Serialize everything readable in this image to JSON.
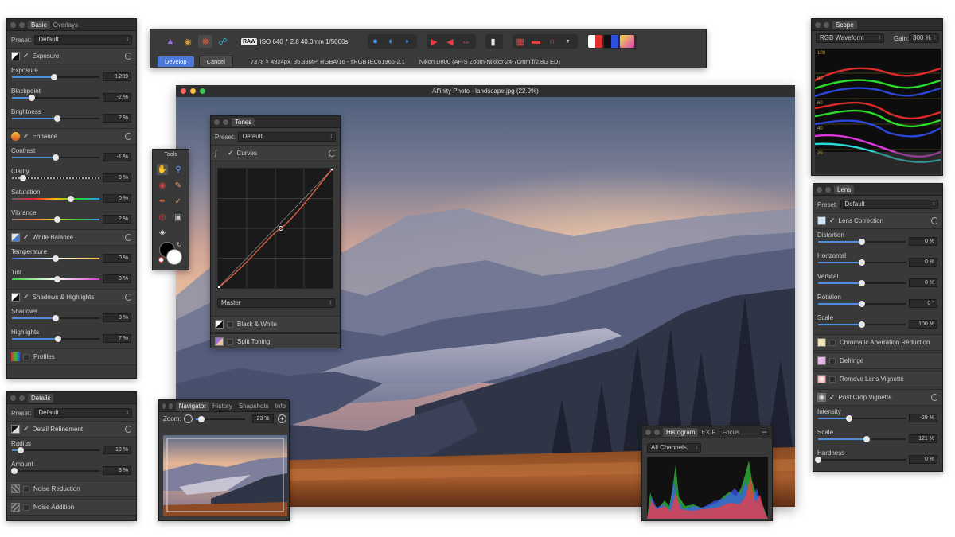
{
  "toolbar": {
    "raw_badge": "RAW",
    "exif_summary": "ISO 640 ƒ 2.8 40.0mm 1/5000s",
    "develop_label": "Develop",
    "cancel_label": "Cancel",
    "image_info": "7378 × 4924px, 36.33MP, RGBA/16 - sRGB IEC61966-2.1",
    "camera_info": "Nikon D800 (AF-S Zoom-Nikkor 24-70mm f/2.8G ED)"
  },
  "main_window": {
    "title": "Affinity Photo - landscape.jpg (22.9%)"
  },
  "basic_panel": {
    "tabs": [
      "Basic",
      "Overlays"
    ],
    "preset_label": "Preset:",
    "preset_value": "Default",
    "sections": [
      {
        "name": "Exposure",
        "sliders": [
          {
            "label": "Exposure",
            "value": "0.289",
            "pos": 0.48
          },
          {
            "label": "Blackpoint",
            "value": "-2 %",
            "pos": 0.23
          },
          {
            "label": "Brightness",
            "value": "2 %",
            "pos": 0.52
          }
        ]
      },
      {
        "name": "Enhance",
        "sliders": [
          {
            "label": "Contrast",
            "value": "-1 %",
            "pos": 0.5
          },
          {
            "label": "Clarity",
            "value": "9 %",
            "pos": 0.13
          },
          {
            "label": "Saturation",
            "value": "0 %",
            "pos": 0.67
          },
          {
            "label": "Vibrance",
            "value": "2 %",
            "pos": 0.52
          }
        ]
      },
      {
        "name": "White Balance",
        "sliders": [
          {
            "label": "Temperature",
            "value": "0 %",
            "pos": 0.5
          },
          {
            "label": "Tint",
            "value": "3 %",
            "pos": 0.52
          }
        ]
      },
      {
        "name": "Shadows & Highlights",
        "sliders": [
          {
            "label": "Shadows",
            "value": "0 %",
            "pos": 0.5
          },
          {
            "label": "Highlights",
            "value": "7 %",
            "pos": 0.53
          }
        ]
      }
    ],
    "profiles_label": "Profiles"
  },
  "details_panel": {
    "tab": "Details",
    "preset_label": "Preset:",
    "preset_value": "Default",
    "section": "Detail Refinement",
    "sliders": [
      {
        "label": "Radius",
        "value": "10 %",
        "pos": 0.1
      },
      {
        "label": "Amount",
        "value": "3 %",
        "pos": 0.03
      }
    ],
    "noise_reduction": "Noise Reduction",
    "noise_addition": "Noise Addition"
  },
  "tools_panel": {
    "title": "Tools"
  },
  "tones_panel": {
    "tab": "Tones",
    "preset_label": "Preset:",
    "preset_value": "Default",
    "curves_label": "Curves",
    "channel": "Master",
    "black_white_label": "Black & White",
    "split_toning_label": "Split Toning"
  },
  "navigator_panel": {
    "tabs": [
      "Navigator",
      "History",
      "Snapshots",
      "Info"
    ],
    "zoom_label": "Zoom:",
    "zoom_value": "23 %",
    "zoom_level": 0.12
  },
  "histogram_panel": {
    "tabs": [
      "Histogram",
      "EXIF",
      "Focus"
    ],
    "channel": "All Channels"
  },
  "scope_panel": {
    "tab": "Scope",
    "mode": "RGB Waveform",
    "gain_label": "Gain:",
    "gain_value": "300 %",
    "scale_labels": [
      "100",
      "80",
      "60",
      "40",
      "20"
    ]
  },
  "lens_panel": {
    "tab": "Lens",
    "preset_label": "Preset:",
    "preset_value": "Default",
    "lens_correction": "Lens Correction",
    "sliders": [
      {
        "label": "Distortion",
        "value": "0 %",
        "pos": 0.5
      },
      {
        "label": "Horizontal",
        "value": "0 %",
        "pos": 0.5
      },
      {
        "label": "Vertical",
        "value": "0 %",
        "pos": 0.5
      },
      {
        "label": "Rotation",
        "value": "0 °",
        "pos": 0.5
      },
      {
        "label": "Scale",
        "value": "100 %",
        "pos": 0.5
      }
    ],
    "chromatic": "Chromatic Aberration Reduction",
    "defringe": "Defringe",
    "remove_vignette": "Remove Lens Vignette",
    "post_crop": "Post Crop Vignette",
    "post_sliders": [
      {
        "label": "Intensity",
        "value": "-29 %",
        "pos": 0.35
      },
      {
        "label": "Scale",
        "value": "121 %",
        "pos": 0.55
      },
      {
        "label": "Hardness",
        "value": "0 %",
        "pos": 0.0
      }
    ]
  },
  "colors": {
    "accent": "#4c77d6",
    "panel_bg": "#393939",
    "develop_button": "#4c77d6"
  }
}
